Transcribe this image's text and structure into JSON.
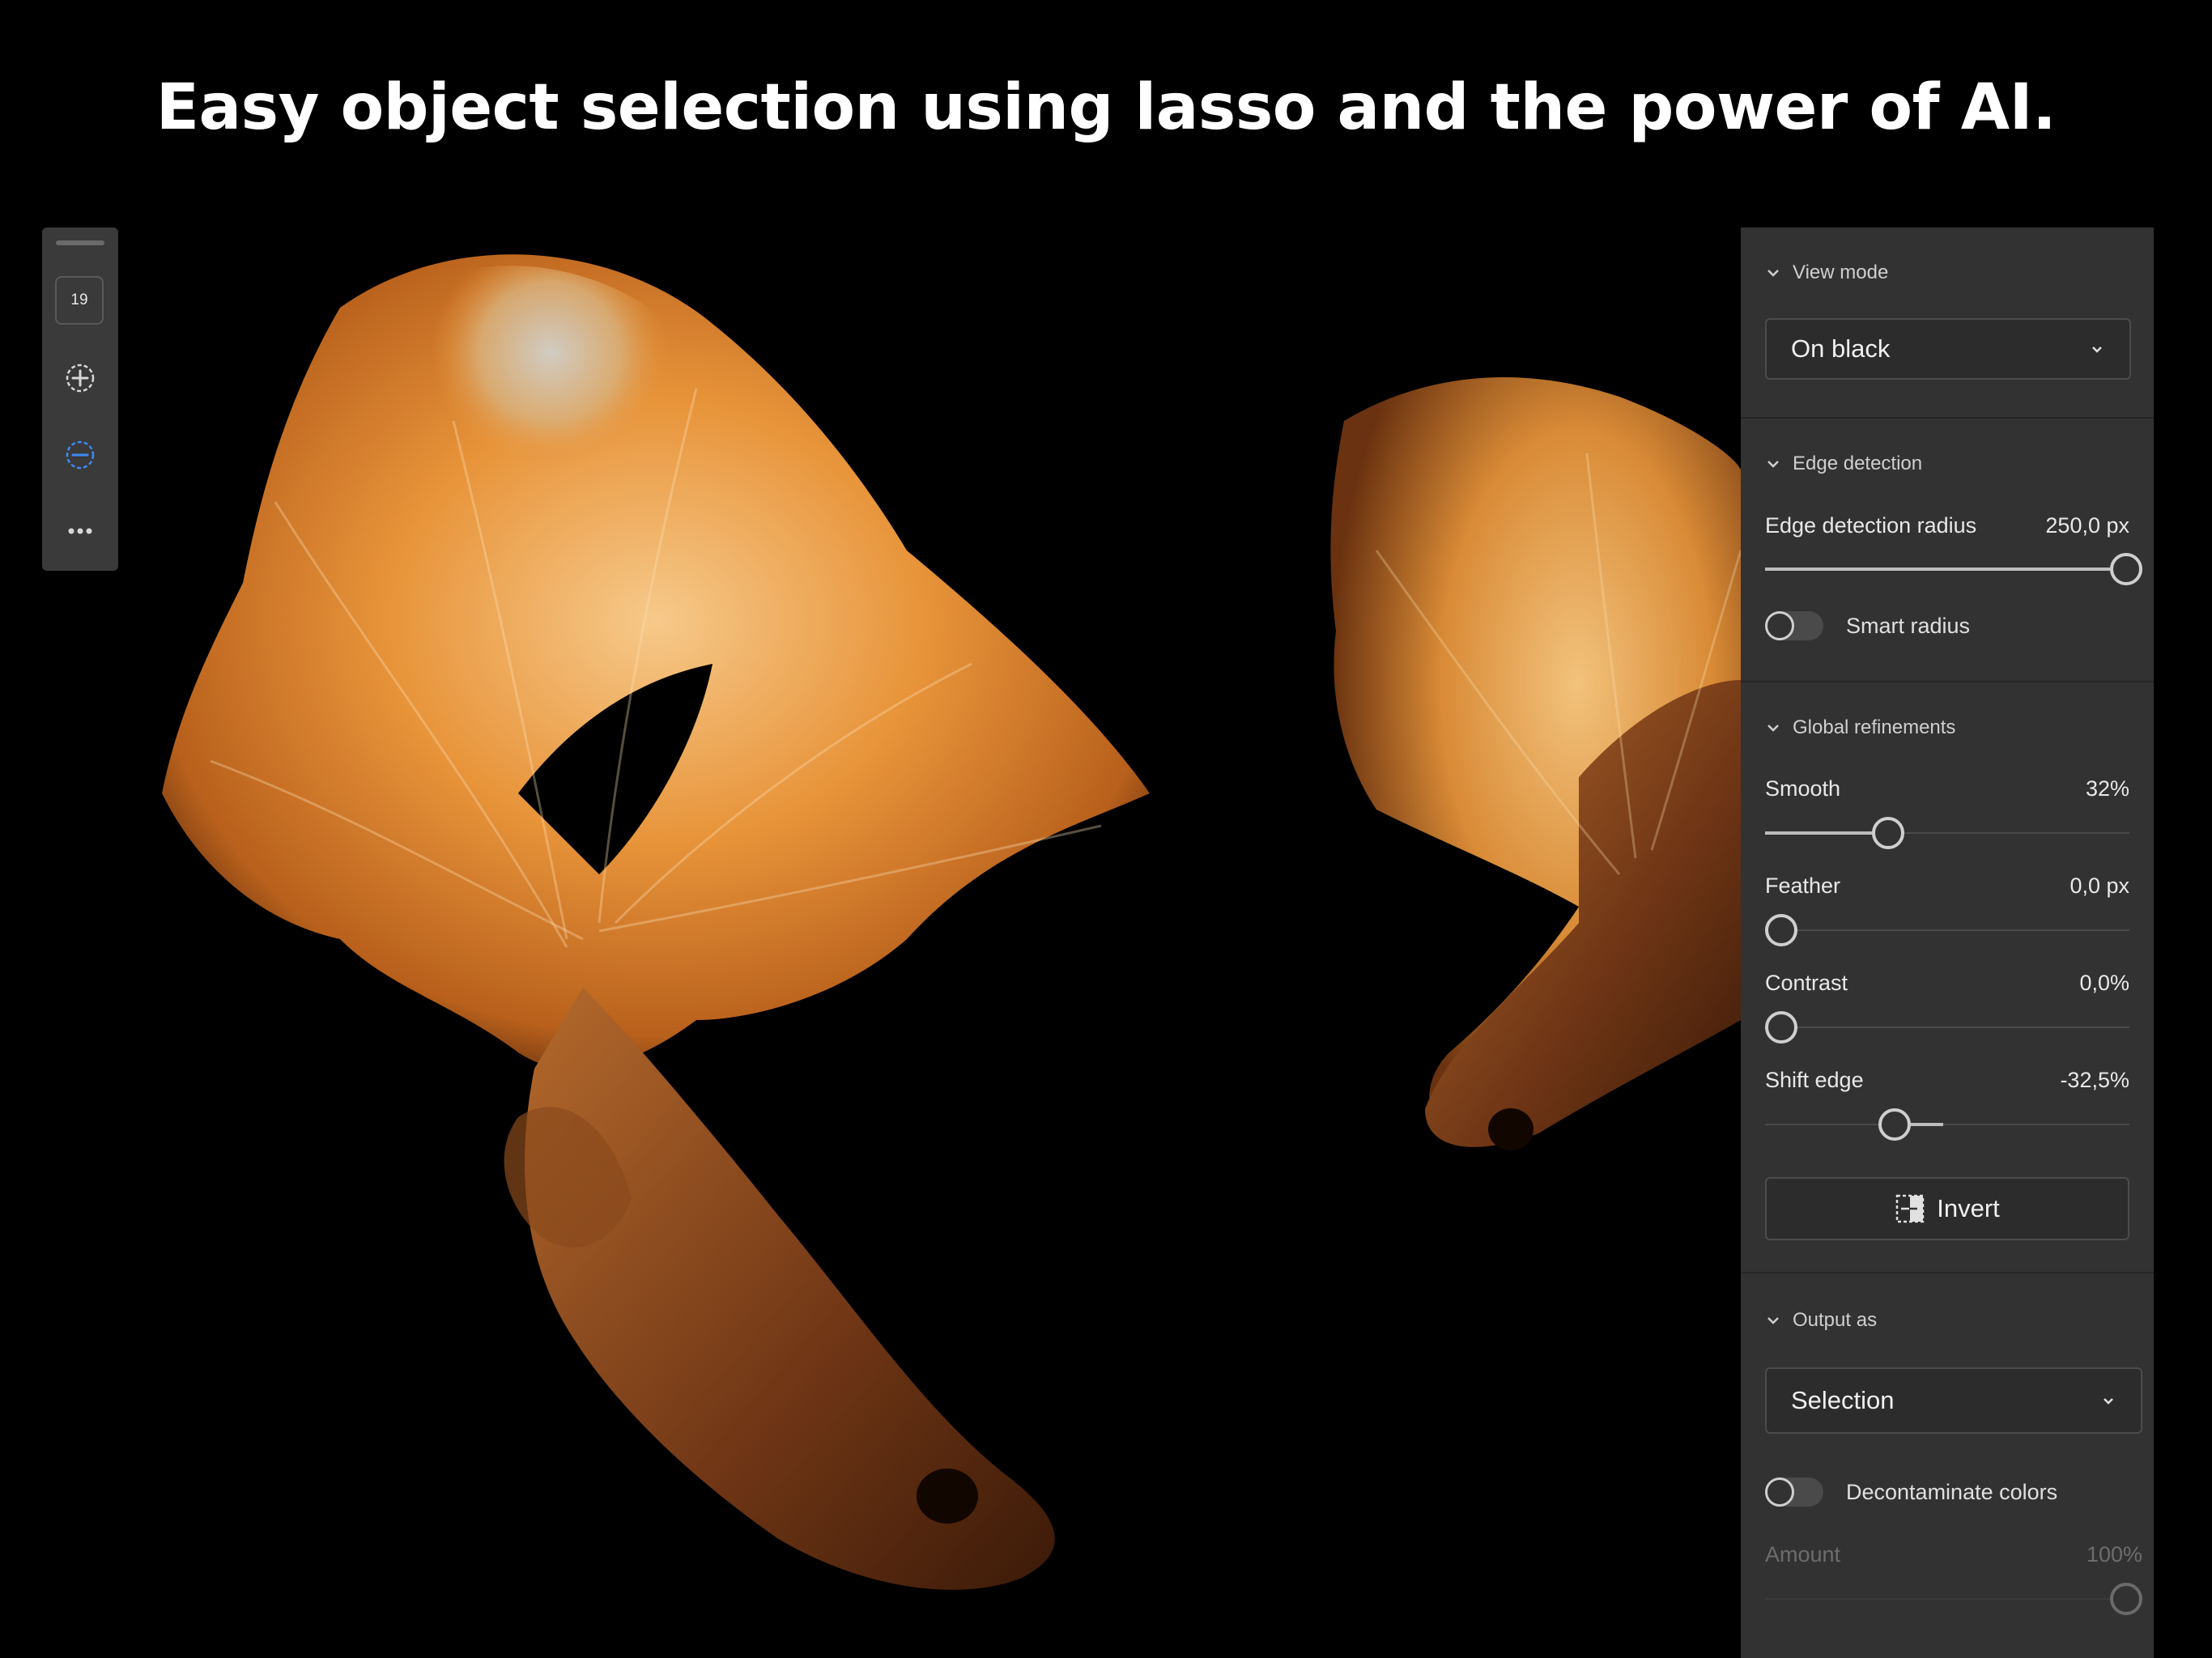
{
  "headline": "Easy object selection using lasso and the power of AI.",
  "toolbar": {
    "brush_size": "19",
    "tools": [
      {
        "name": "add-selection-icon",
        "active": false
      },
      {
        "name": "subtract-selection-icon",
        "active": true
      },
      {
        "name": "more-icon",
        "active": false
      }
    ]
  },
  "panel": {
    "view_mode": {
      "title": "View mode",
      "value": "On black"
    },
    "edge_detection": {
      "title": "Edge detection",
      "radius_label": "Edge detection radius",
      "radius_value": "250,0 px",
      "radius_fraction": 1.0,
      "smart_radius_label": "Smart radius",
      "smart_radius_on": false
    },
    "global_refinements": {
      "title": "Global refinements",
      "smooth_label": "Smooth",
      "smooth_value": "32%",
      "smooth_fraction": 0.32,
      "feather_label": "Feather",
      "feather_value": "0,0 px",
      "contrast_label": "Contrast",
      "contrast_value": "0,0%",
      "shift_edge_label": "Shift edge",
      "shift_edge_value": "-32,5%",
      "invert_label": "Invert"
    },
    "output_as": {
      "title": "Output as",
      "value": "Selection",
      "decontaminate_label": "Decontaminate colors",
      "decontaminate_on": false,
      "amount_label": "Amount",
      "amount_value": "100%"
    }
  },
  "colors": {
    "accent_blue": "#3d8af7",
    "panel_bg": "#323232",
    "fish_orange": "#e8943a"
  }
}
